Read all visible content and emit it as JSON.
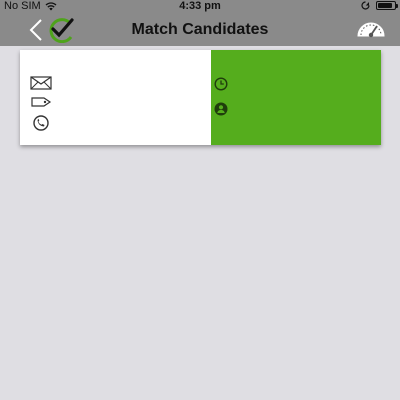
{
  "status_bar": {
    "carrier": "No SIM",
    "time": "4:33 pm",
    "battery_level": 0.9
  },
  "nav": {
    "title": "Match Candidates",
    "back_icon": "chevron-left-icon",
    "logo_icon": "checkmark-logo-icon",
    "right_icon": "speedometer-icon"
  },
  "card": {
    "colors": {
      "left_bg": "#ffffff",
      "right_bg": "#55ad1d"
    },
    "left_rows": [
      {
        "icon": "envelope-icon",
        "text": ""
      },
      {
        "icon": "tag-icon",
        "text": ""
      },
      {
        "icon": "phone-icon",
        "text": ""
      }
    ],
    "right_rows": [
      {
        "icon": "clock-icon",
        "text": ""
      },
      {
        "icon": "person-icon",
        "text": ""
      }
    ]
  }
}
